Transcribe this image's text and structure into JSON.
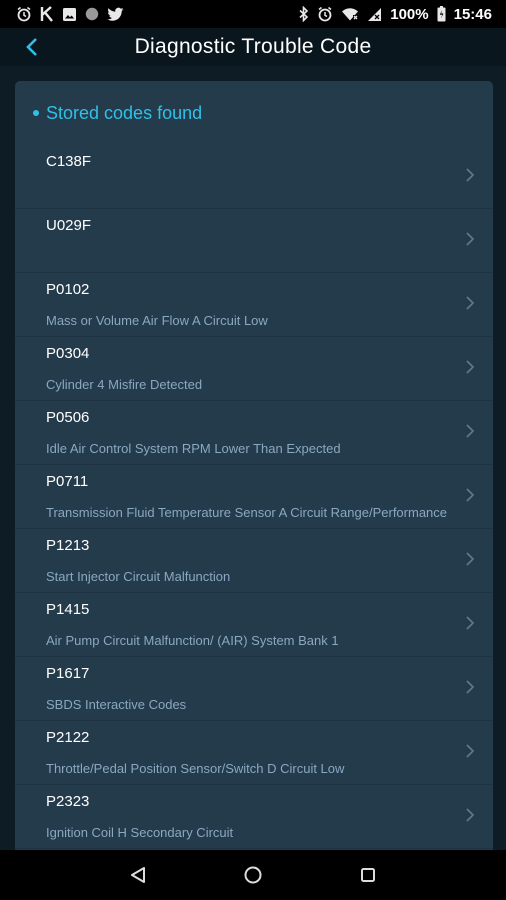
{
  "status_bar": {
    "left_icons": [
      "alarm-icon",
      "k-app-icon",
      "image-icon",
      "circle-icon",
      "twitter-icon"
    ],
    "right_icons": [
      "bluetooth-icon",
      "alarm-icon",
      "wifi-icon",
      "signal-icon",
      "battery-icon"
    ],
    "battery": "100%",
    "time": "15:46"
  },
  "app_bar": {
    "title": "Diagnostic Trouble Code"
  },
  "card": {
    "heading": "Stored codes found",
    "accent_color": "#2fc0e8"
  },
  "codes": [
    {
      "code": "C138F",
      "description": ""
    },
    {
      "code": "U029F",
      "description": ""
    },
    {
      "code": "P0102",
      "description": "Mass or Volume Air Flow A Circuit Low"
    },
    {
      "code": "P0304",
      "description": "Cylinder 4 Misfire Detected"
    },
    {
      "code": "P0506",
      "description": "Idle Air Control System RPM Lower Than Expected"
    },
    {
      "code": "P0711",
      "description": "Transmission Fluid Temperature Sensor A Circuit Range/Performance"
    },
    {
      "code": "P1213",
      "description": "Start Injector Circuit Malfunction"
    },
    {
      "code": "P1415",
      "description": "Air Pump Circuit Malfunction/ (AIR) System Bank 1"
    },
    {
      "code": "P1617",
      "description": "SBDS Interactive Codes"
    },
    {
      "code": "P2122",
      "description": "Throttle/Pedal Position Sensor/Switch D Circuit Low"
    },
    {
      "code": "P2323",
      "description": "Ignition Coil H Secondary Circuit"
    }
  ],
  "nav_bar": {
    "buttons": [
      "back-triangle-icon",
      "home-circle-icon",
      "recents-square-icon"
    ]
  }
}
